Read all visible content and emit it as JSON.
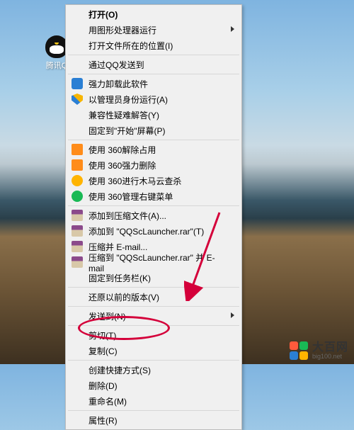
{
  "desktop": {
    "qq_label": "腾讯Q"
  },
  "menu": {
    "open": "打开(O)",
    "gpu_run": "用图形处理器运行",
    "open_location": "打开文件所在的位置(I)",
    "qq_send": "通过QQ发送到",
    "uninstall": "强力卸载此软件",
    "admin": "以管理员身份运行(A)",
    "compat": "兼容性疑难解答(Y)",
    "pin_start": "固定到\"开始\"屏幕(P)",
    "s360_unlock": "使用 360解除占用",
    "s360_force_del": "使用 360强力删除",
    "s360_cloud": "使用 360进行木马云查杀",
    "s360_menu": "使用 360管理右键菜单",
    "add_archive": "添加到压缩文件(A)...",
    "add_to_rar": "添加到 \"QQScLauncher.rar\"(T)",
    "email": "压缩并 E-mail...",
    "email_rar": "压缩到 \"QQScLauncher.rar\" 并 E-mail",
    "pin_taskbar": "固定到任务栏(K)",
    "restore_prev": "还原以前的版本(V)",
    "send_to": "发送到(N)",
    "cut": "剪切(T)",
    "copy": "复制(C)",
    "shortcut": "创建快捷方式(S)",
    "delete": "删除(D)",
    "rename": "重命名(M)",
    "properties": "属性(R)"
  },
  "watermark": {
    "title": "大百网",
    "url": "big100.net"
  }
}
